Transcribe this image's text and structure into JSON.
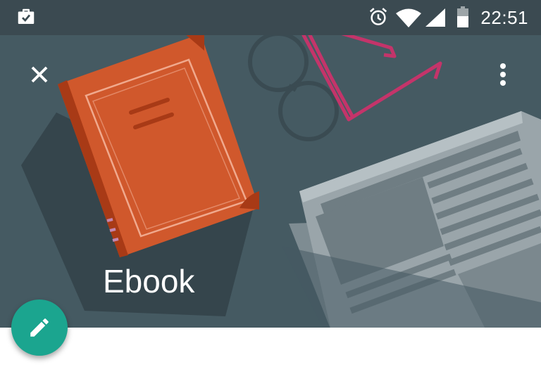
{
  "status_bar": {
    "time": "22:51",
    "icons": [
      "briefcase-check-icon",
      "alarm-icon",
      "wifi-icon",
      "signal-icon",
      "battery-icon"
    ]
  },
  "toolbar": {
    "close_icon": "close-icon",
    "more_icon": "more-vert-icon"
  },
  "header": {
    "title": "Ebook",
    "illustration": [
      "book-icon",
      "glasses-icon",
      "newspaper-icon"
    ]
  },
  "fab": {
    "icon": "pencil-icon"
  },
  "colors": {
    "status_bar_bg": "#3b4a51",
    "hero_bg": "#455a62",
    "book": "#d0582c",
    "glasses": "#c4346a",
    "fab": "#1ba58f"
  }
}
